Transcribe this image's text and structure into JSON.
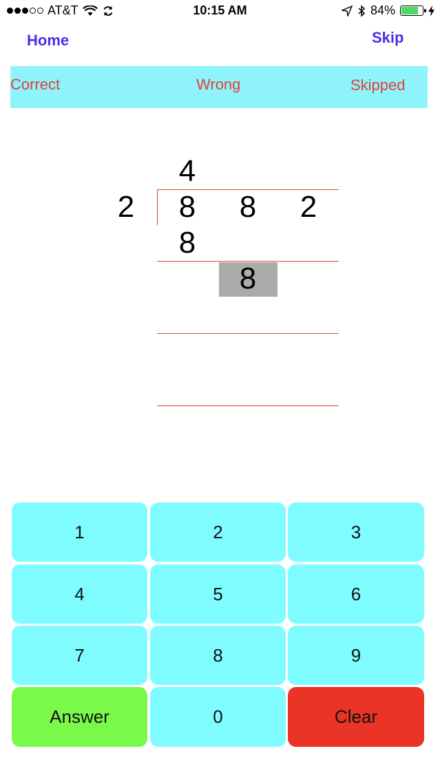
{
  "status_bar": {
    "carrier": "AT&T",
    "time": "10:15 AM",
    "battery": "84%",
    "battery_level": 0.84,
    "icons": [
      "signal-dots",
      "wifi-icon",
      "sync-icon",
      "location-arrow-icon",
      "bluetooth-icon",
      "battery-icon",
      "charging-bolt-icon"
    ]
  },
  "nav": {
    "home": "Home",
    "skip": "Skip"
  },
  "score_bar": {
    "correct": "Correct",
    "wrong": "Wrong",
    "skipped": "Skipped"
  },
  "problem": {
    "quotient": "4",
    "divisor": "2",
    "dividend": [
      "8",
      "8",
      "2"
    ],
    "step_product": "8",
    "step_input": "8"
  },
  "keypad": {
    "k1": "1",
    "k2": "2",
    "k3": "3",
    "k4": "4",
    "k5": "5",
    "k6": "6",
    "k7": "7",
    "k8": "8",
    "k9": "9",
    "answer": "Answer",
    "k0": "0",
    "clear": "Clear"
  },
  "colors": {
    "nav_link": "#4b2fe8",
    "score_bar_bg": "#8ff3fb",
    "score_text": "#e0413a",
    "key_bg": "#7ffcff",
    "answer_bg": "#7af94a",
    "clear_bg": "#ea3426",
    "input_box": "#aaaaaa",
    "rule_line": "#e0413a"
  }
}
